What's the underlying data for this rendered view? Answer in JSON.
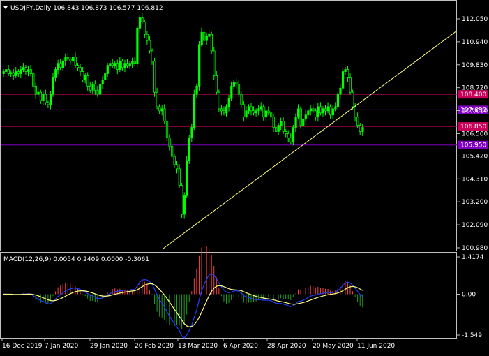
{
  "header": {
    "symbol_line": "USDJPY,Daily  106.843 106.873 106.577 106.812"
  },
  "colors": {
    "bull": "#00ff00",
    "bear": "#00ff00",
    "trendline": "#ffff80",
    "level_red": "#c8005a",
    "level_purple": "#8000c0",
    "axis": "#c0c0c0",
    "macd_line": "#2040ff",
    "signal_line": "#ffff80",
    "hist_pos": "#ff4040",
    "hist_neg": "#20a020"
  },
  "chart_data": [
    {
      "type": "candlestick",
      "title": "USDJPY,Daily",
      "ohlc_label": "106.843 106.873 106.577 106.812",
      "ylim": [
        100.98,
        112.6
      ],
      "y_ticks": [
        "112.050",
        "110.940",
        "109.830",
        "108.720",
        "107.610",
        "106.500",
        "105.420",
        "104.310",
        "103.200",
        "102.090",
        "100.980"
      ],
      "x_ticks": [
        "16 Dec 2019",
        "7 Jan 2020",
        "29 Jan 2020",
        "20 Feb 2020",
        "13 Mar 2020",
        "6 Apr 2020",
        "28 Apr 2020",
        "20 May 2020",
        "11 Jun 2020"
      ],
      "close": [
        109.5,
        109.6,
        109.4,
        109.45,
        109.3,
        109.5,
        109.4,
        109.6,
        109.7,
        109.5,
        109.6,
        109.4,
        108.8,
        108.4,
        108.5,
        108.1,
        108.4,
        108.0,
        107.9,
        108.4,
        109.2,
        109.6,
        109.9,
        109.7,
        110.0,
        110.2,
        110.1,
        110.0,
        110.2,
        109.8,
        109.7,
        109.5,
        109.1,
        109.3,
        108.8,
        108.6,
        108.9,
        108.6,
        108.4,
        108.9,
        109.1,
        109.4,
        109.8,
        109.9,
        109.8,
        109.9,
        109.6,
        110.0,
        109.7,
        109.9,
        109.8,
        109.9,
        110.0,
        109.9,
        111.6,
        112.1,
        111.9,
        111.3,
        111.0,
        110.5,
        110.0,
        108.5,
        107.8,
        107.6,
        107.7,
        107.1,
        106.3,
        105.9,
        105.4,
        105.0,
        104.8,
        104.0,
        102.6,
        103.5,
        105.2,
        106.3,
        106.8,
        108.4,
        108.8,
        110.8,
        111.4,
        111.0,
        111.2,
        111.3,
        110.5,
        109.3,
        108.5,
        107.7,
        107.6,
        107.5,
        107.8,
        108.2,
        108.8,
        109.0,
        108.9,
        108.4,
        107.9,
        107.3,
        107.6,
        107.8,
        107.6,
        107.5,
        107.6,
        107.7,
        107.8,
        107.3,
        107.6,
        107.5,
        107.3,
        106.8,
        106.6,
        106.9,
        107.1,
        106.6,
        106.5,
        106.3,
        106.1,
        106.8,
        107.3,
        107.7,
        106.9,
        107.2,
        107.4,
        107.6,
        107.7,
        107.6,
        107.3,
        107.8,
        107.5,
        107.7,
        107.6,
        107.8,
        107.4,
        107.7,
        107.8,
        108.4,
        108.7,
        109.5,
        109.6,
        109.2,
        108.5,
        107.8,
        107.3,
        106.9,
        106.6,
        106.8
      ],
      "levels": [
        {
          "value": "108.400",
          "color": "red"
        },
        {
          "value": "107.650",
          "color": "purple"
        },
        {
          "value": "106.850",
          "color": "red"
        },
        {
          "value": "105.950",
          "color": "purple"
        }
      ]
    },
    {
      "type": "macd",
      "title": "MACD(12,26,9) 0.0054 0.2409 0.0000 -0.3061",
      "ylim": [
        -1.549,
        1.4174
      ],
      "y_ticks": [
        "1.4174",
        "0.00",
        "-1.549"
      ]
    }
  ]
}
